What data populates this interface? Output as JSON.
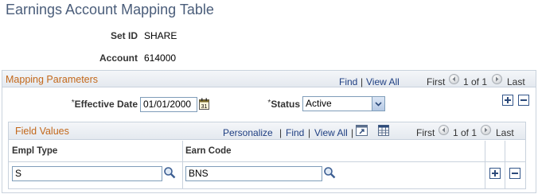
{
  "page": {
    "title": "Earnings Account Mapping Table"
  },
  "header_fields": {
    "setid_label": "Set ID",
    "setid_value": "SHARE",
    "account_label": "Account",
    "account_value": "614000"
  },
  "mapping_parameters": {
    "title": "Mapping Parameters",
    "find": "Find",
    "separator": "|",
    "view_all": "View All",
    "first": "First",
    "counter": "1 of 1",
    "last": "Last",
    "effdt_label": "Effective Date",
    "effdt_value": "01/01/2000",
    "status_label": "Status",
    "status_value": "Active",
    "required_marker": "*"
  },
  "field_values": {
    "title": "Field Values",
    "personalize": "Personalize",
    "find": "Find",
    "separator": "|",
    "view_all": "View All",
    "first": "First",
    "counter": "1 of 1",
    "last": "Last",
    "columns": [
      "Empl Type",
      "Earn Code"
    ],
    "rows": [
      {
        "empl_type": "S",
        "earn_code": "BNS"
      }
    ]
  },
  "icons": {
    "calendar": "calendar-icon",
    "lookup": "magnifier-icon",
    "prev": "arrow-left-icon",
    "next": "arrow-right-icon",
    "add": "plus-icon",
    "delete": "minus-icon",
    "zoom": "grid-zoom-icon",
    "download": "spreadsheet-icon"
  },
  "colors": {
    "title": "#4a5d7a",
    "section_title": "#c3681b",
    "link": "#1f3f82",
    "border": "#c9d2dd"
  }
}
